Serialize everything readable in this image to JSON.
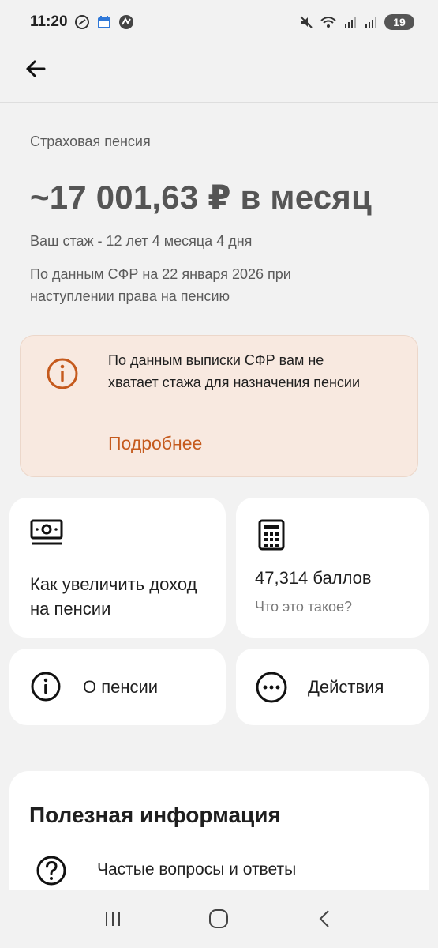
{
  "status_bar": {
    "time": "11:20",
    "battery": "19",
    "left_icons": [
      "circle-status-icon",
      "calendar-icon",
      "app-icon"
    ],
    "right_icons": [
      "mute-icon",
      "wifi-icon",
      "signal-icon",
      "signal-icon-2"
    ]
  },
  "header": {
    "back_icon": "arrow-left-icon"
  },
  "pension": {
    "label": "Страховая пенсия",
    "amount": "~17 001,63 ₽ в месяц",
    "experience": "Ваш стаж - 12 лет 4 месяца 4 дня",
    "source_note": "По данным СФР на 22 января 2026 при наступлении права на пенсию"
  },
  "warning": {
    "icon": "info-warning-icon",
    "text": "По данным выписки СФР вам не хватает стажа для назначения пенсии",
    "link": "Подробнее"
  },
  "tiles": {
    "increase": {
      "icon": "money-bill-icon",
      "title": "Как увеличить доход на пенсии"
    },
    "points": {
      "icon": "calculator-icon",
      "title": "47,314 баллов",
      "subtitle": "Что это такое?"
    },
    "about": {
      "icon": "info-circle-icon",
      "title": "О пенсии"
    },
    "actions": {
      "icon": "more-dots-icon",
      "title": "Действия"
    }
  },
  "useful_info": {
    "title": "Полезная информация",
    "items": [
      {
        "icon": "question-circle-icon",
        "label": "Частые вопросы и ответы"
      }
    ]
  },
  "navigation": {
    "buttons": [
      "recent-apps-icon",
      "home-icon",
      "back-icon"
    ]
  },
  "colors": {
    "background": "#f2f2f2",
    "warning_bg": "#f8e9e0",
    "accent": "#c55a1d",
    "text": "#1f1f1f",
    "muted": "#5b5b5b"
  }
}
